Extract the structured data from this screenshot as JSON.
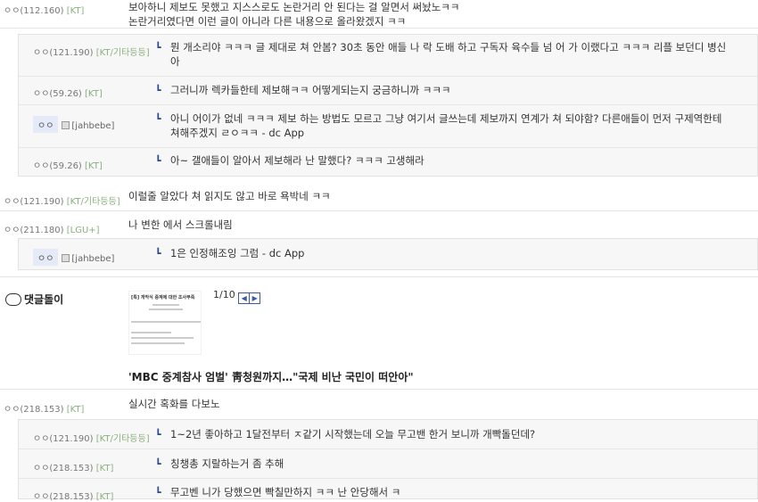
{
  "comments": [
    {
      "ip": "ㅇㅇ(112.160)",
      "carrier": "[KT]",
      "lines": [
        "보아하니 제보도 못했고 지스스로도 논란거리 안 된다는 걸 알면서 써놨노ㅋㅋ",
        "논란거리였다면 이런 글이 아니라 다른 내용으로 올라왔겠지 ㅋㅋ"
      ]
    },
    {
      "ip": "ㅇㅇ(121.190)",
      "carrier": "[KT/기타등등]",
      "lines": [
        "이럴줄 알았다 쳐 읽지도 않고 바로 욕박네 ㅋㅋ"
      ]
    },
    {
      "ip": "ㅇㅇ(211.180)",
      "carrier": "[LGU+]",
      "lines": [
        "나 변한 에서 스크롤내림"
      ]
    },
    {
      "ip": "ㅇㅇ(218.153)",
      "carrier": "[KT]",
      "lines": [
        "실시간 혹화를 다보노"
      ]
    }
  ],
  "replies1": [
    {
      "ip": "ㅇㅇ(121.190)",
      "carrier": "[KT/기타등등]",
      "lines": [
        "뭔 개소리야 ㅋㅋㅋ 글 제대로 쳐 안봄? 30초 동안 애들 나 락 도배 하고 구독자 육수들 넘 어 가 이랬다고 ㅋㅋㅋ 리플 보던디 병신",
        "아"
      ]
    },
    {
      "ip": "ㅇㅇ(59.26)",
      "carrier": "[KT]",
      "lines": [
        "그러니까 렉카들한테 제보해ㅋㅋ 어떻게되는지 궁금하니까 ㅋㅋㅋ"
      ]
    },
    {
      "nick": "ㅇㅇ",
      "id": "[jahbebe]",
      "lines": [
        "아니 어이가 없네 ㅋㅋㅋ 제보 하는 방법도 모르고 그냥 여기서 글쓰는데 제보까지 연계가 쳐 되야함? 다른애들이 먼저 구제역한테",
        "쳐해주겠지 ㄹㅇㅋㅋ - dc App"
      ]
    },
    {
      "ip": "ㅇㅇ(59.26)",
      "carrier": "[KT]",
      "lines": [
        "아~ 갤애들이 알아서 제보해라 난 말했다? ㅋㅋㅋ 고생해라"
      ]
    }
  ],
  "replies2": [
    {
      "nick": "ㅇㅇ",
      "id": "[jahbebe]",
      "lines": [
        "1은 인정해조잉 그럼 - dc App"
      ]
    }
  ],
  "replies3": [
    {
      "ip": "ㅇㅇ(121.190)",
      "carrier": "[KT/기타등등]",
      "lines": [
        "1~2년 좋아하고 1달전부터 ㅈ같기 시작했는데 오늘 무고밴 한거 보니까 개빡돌던데?"
      ]
    },
    {
      "ip": "ㅇㅇ(218.153)",
      "carrier": "[KT]",
      "lines": [
        "칭챙총 지랄하는거 좀 추해"
      ]
    },
    {
      "ip": "ㅇㅇ(218.153)",
      "carrier": "[KT]",
      "lines": [
        "무고벤 니가 당했으면 빡칠만하지 ㅋㅋ 난 안당해서 ㅋ"
      ]
    }
  ],
  "bot": {
    "label": "댓글돌이",
    "thumb_title": "[특] 개막식 중계에 대한 조사부족",
    "page": "1/10",
    "headline": "'MBC 중계참사 엄벌' 靑청원까지…\"국제 비난 국민이 떠안아\""
  },
  "icons": {
    "reply_arrow": "reply-arrow-icon",
    "gallery": "gallery-icon",
    "bot": "smile-icon",
    "prev": "prev-arrow-icon",
    "next": "next-arrow-icon"
  },
  "colors": {
    "carrier": "#8ab07e",
    "arrow": "#2a4a8a",
    "nick_bg": "#e4eaf8"
  }
}
